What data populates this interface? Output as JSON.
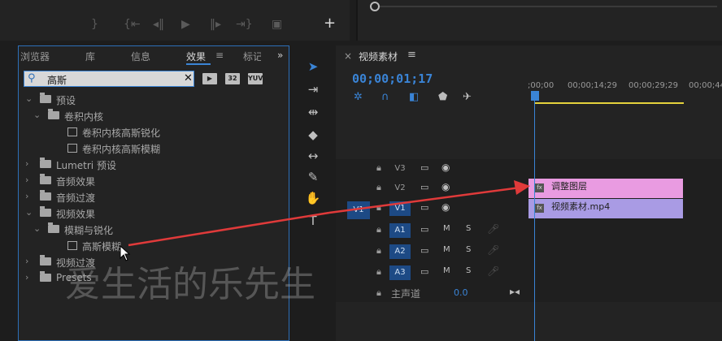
{
  "monitor": {
    "add_label": "+"
  },
  "effects_panel": {
    "tabs": [
      {
        "label": "浏览器"
      },
      {
        "label": "库"
      },
      {
        "label": "信息"
      },
      {
        "label": "效果"
      },
      {
        "label": "标记"
      }
    ],
    "overflow_label": "»",
    "search": {
      "value": "高斯",
      "placeholder": ""
    },
    "filter_buttons": [
      "▶",
      "32",
      "YUV"
    ],
    "tree": [
      {
        "label": "预设",
        "level": 0,
        "expanded": true,
        "kind": "folder"
      },
      {
        "label": "卷积内核",
        "level": 1,
        "expanded": true,
        "kind": "folder"
      },
      {
        "label": "卷积内核高斯锐化",
        "level": 2,
        "kind": "effect"
      },
      {
        "label": "卷积内核高斯模糊",
        "level": 2,
        "kind": "effect"
      },
      {
        "label": "Lumetri 预设",
        "level": 0,
        "expanded": false,
        "kind": "folder"
      },
      {
        "label": "音频效果",
        "level": 0,
        "expanded": false,
        "kind": "folder"
      },
      {
        "label": "音频过渡",
        "level": 0,
        "expanded": false,
        "kind": "folder"
      },
      {
        "label": "视频效果",
        "level": 0,
        "expanded": true,
        "kind": "folder"
      },
      {
        "label": "模糊与锐化",
        "level": 1,
        "expanded": true,
        "kind": "folder"
      },
      {
        "label": "高斯模糊",
        "level": 2,
        "kind": "effect"
      },
      {
        "label": "视频过渡",
        "level": 0,
        "expanded": false,
        "kind": "folder"
      },
      {
        "label": "Presets",
        "level": 0,
        "expanded": false,
        "kind": "folder"
      }
    ]
  },
  "timeline": {
    "close_label": "×",
    "title": "视频素材",
    "menu_label": "≡",
    "timecode": "00;00;01;17",
    "ruler": [
      ";00;00",
      "00;00;14;29",
      "00;00;29;29",
      "00;00;44"
    ],
    "tracks": [
      {
        "name": "V3",
        "type": "video",
        "targeted": false
      },
      {
        "name": "V2",
        "type": "video",
        "targeted": false
      },
      {
        "name": "V1",
        "type": "video",
        "targeted": true
      },
      {
        "name": "A1",
        "type": "audio",
        "targeted": true
      },
      {
        "name": "A2",
        "type": "audio",
        "targeted": true
      },
      {
        "name": "A3",
        "type": "audio",
        "targeted": true
      }
    ],
    "source_patch": "V1",
    "mute_label": "M",
    "solo_label": "S",
    "clips": [
      {
        "label": "调整图层",
        "track": "V2",
        "color": "#e99be1"
      },
      {
        "label": "视频素材.mp4",
        "track": "V1",
        "color": "#a99be4"
      }
    ],
    "master": {
      "label": "主声道",
      "value": "0.0"
    }
  },
  "watermark": "爱生活的乐先生",
  "colors": {
    "accent": "#3a84d6",
    "arrow": "#e03a3a",
    "panel_border": "#2d6fb8"
  }
}
